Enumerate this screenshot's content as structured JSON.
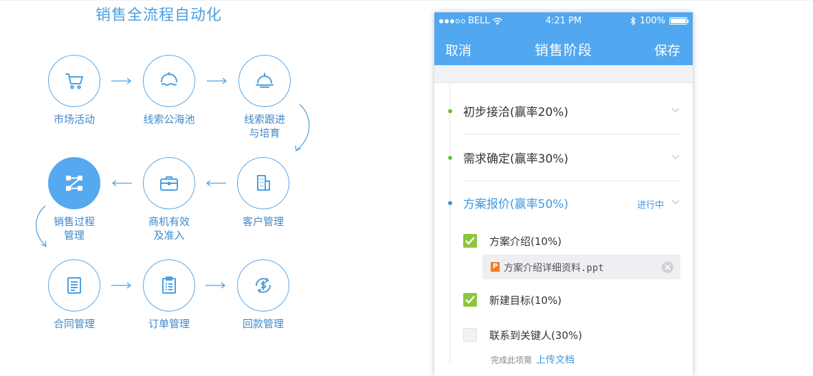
{
  "flow": {
    "title": "销售全流程自动化",
    "steps": [
      {
        "label": [
          "市场活动"
        ],
        "icon": "cart-icon"
      },
      {
        "label": [
          "线索公海池"
        ],
        "icon": "lead-pool-icon"
      },
      {
        "label": [
          "线索跟进",
          "与培育"
        ],
        "icon": "lead-nurture-icon"
      },
      {
        "label": [
          "客户管理"
        ],
        "icon": "building-icon"
      },
      {
        "label": [
          "商机有效",
          "及准入"
        ],
        "icon": "briefcase-icon"
      },
      {
        "label": [
          "销售过程",
          "管理"
        ],
        "icon": "process-icon"
      },
      {
        "label": [
          "合同管理"
        ],
        "icon": "contract-icon"
      },
      {
        "label": [
          "订单管理"
        ],
        "icon": "order-icon"
      },
      {
        "label": [
          "回款管理"
        ],
        "icon": "payment-icon"
      }
    ],
    "active_step": "销售过程管理",
    "accent_color": "#4a9fe0"
  },
  "phone": {
    "status": {
      "carrier": "BELL",
      "time": "4:21 PM",
      "battery": "100%"
    },
    "nav": {
      "cancel": "取消",
      "title": "销售阶段",
      "save": "保存"
    },
    "stages": [
      {
        "label": "初步接洽(赢率20%)"
      },
      {
        "label": "需求确定(赢率30%)"
      },
      {
        "label": "方案报价(赢率50%)",
        "status": "进行中"
      }
    ],
    "tasks": [
      {
        "label": "方案介绍(10%)",
        "checked": true
      },
      {
        "label": "新建目标(10%)",
        "checked": true
      },
      {
        "label": "联系到关键人(30%)",
        "checked": false
      }
    ],
    "attachment": {
      "name": "方案介绍详细资料.ppt",
      "badge": "P"
    },
    "hint": {
      "text": "完成此项需",
      "link": "上传文档"
    },
    "colors": {
      "primary": "#51a7f0",
      "check": "#8cc63f",
      "done_dot": "#67c23a"
    }
  }
}
